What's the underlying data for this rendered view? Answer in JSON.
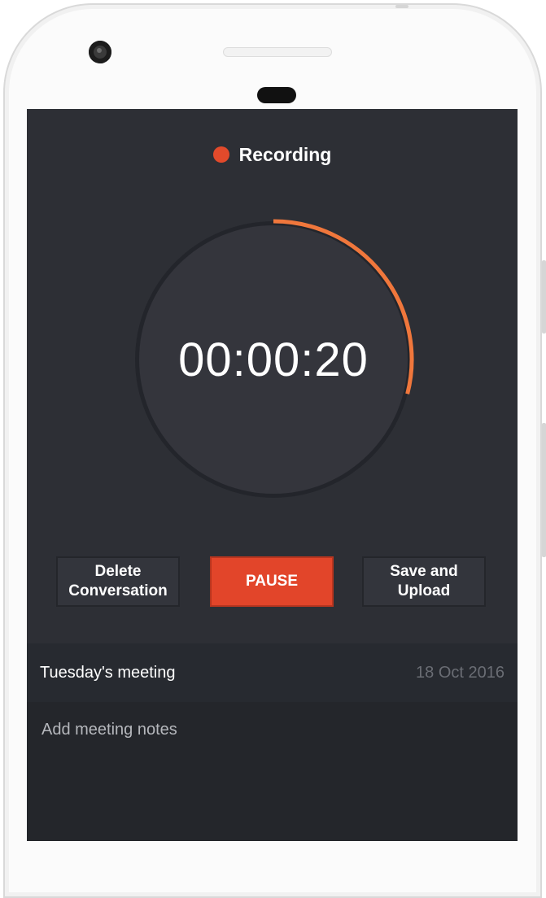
{
  "status": {
    "label": "Recording",
    "dot_color": "#e24a2b"
  },
  "timer": {
    "display": "00:00:20",
    "progress_fraction": 0.29,
    "accent_color": "#f0773c"
  },
  "actions": {
    "delete_label": "Delete\nConversation",
    "pause_label": "PAUSE",
    "save_label": "Save and\nUpload"
  },
  "meeting": {
    "title": "Tuesday's meeting",
    "date": "18 Oct 2016"
  },
  "notes": {
    "placeholder": "Add meeting notes"
  }
}
